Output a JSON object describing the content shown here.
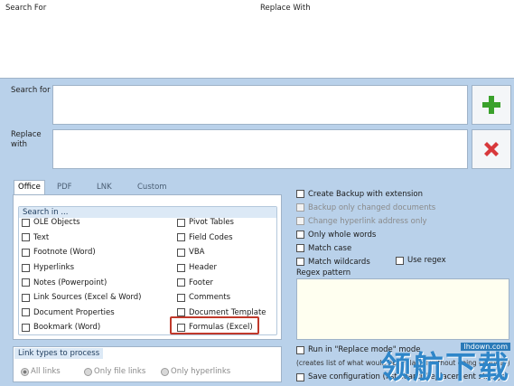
{
  "list": {
    "col_search": "Search For",
    "col_replace": "Replace With"
  },
  "fields": {
    "search_label": "Search for",
    "replace_label": "Replace with",
    "search_value": "",
    "replace_value": ""
  },
  "tabs": [
    {
      "label": "Office"
    },
    {
      "label": "PDF"
    },
    {
      "label": "LNK"
    },
    {
      "label": "Custom"
    }
  ],
  "search_in": {
    "title": "Search in ...",
    "left": [
      "OLE Objects",
      "Text",
      "Footnote (Word)",
      "Hyperlinks",
      "Notes (Powerpoint)",
      "Link Sources (Excel & Word)",
      "Document Properties",
      "Bookmark (Word)"
    ],
    "right": [
      "Pivot Tables",
      "Field Codes",
      "VBA",
      "Header",
      "Footer",
      "Comments",
      "Document Template",
      "Formulas (Excel)"
    ]
  },
  "link_types": {
    "title": "Link types to process",
    "options": [
      "All links",
      "Only file links",
      "Only hyperlinks"
    ],
    "selected": "All links"
  },
  "options": {
    "create_backup": "Create Backup with extension",
    "backup_changed": "Backup only changed documents",
    "change_hyperlink": "Change hyperlink address only",
    "whole_words": "Only whole words",
    "match_case": "Match case",
    "match_wildcards": "Match wildcards",
    "use_regex": "Use regex",
    "regex_label": "Regex pattern",
    "run_in_mode": "Run in \"Replace mode\" mode",
    "note": "(creates list of what would be replaced without doing changes)",
    "save_config": "Save configuration (list search/replacement strings)"
  },
  "watermark": {
    "site": "lhdown.com",
    "text": "领航下载"
  },
  "colors": {
    "background": "#b9d1ea",
    "add_icon": "#3aa12b",
    "delete_icon": "#d8383b",
    "highlight": "#c0392b"
  }
}
